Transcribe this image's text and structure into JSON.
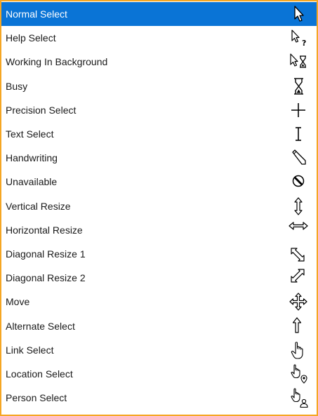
{
  "cursor_list": {
    "selected_index": 0,
    "items": [
      {
        "label": "Normal Select",
        "icon": "arrow-cursor-icon"
      },
      {
        "label": "Help Select",
        "icon": "arrow-question-cursor-icon"
      },
      {
        "label": "Working In Background",
        "icon": "arrow-hourglass-cursor-icon"
      },
      {
        "label": "Busy",
        "icon": "hourglass-cursor-icon"
      },
      {
        "label": "Precision Select",
        "icon": "crosshair-cursor-icon"
      },
      {
        "label": "Text Select",
        "icon": "ibeam-cursor-icon"
      },
      {
        "label": "Handwriting",
        "icon": "pen-cursor-icon"
      },
      {
        "label": "Unavailable",
        "icon": "no-symbol-cursor-icon"
      },
      {
        "label": "Vertical Resize",
        "icon": "vertical-resize-cursor-icon"
      },
      {
        "label": "Horizontal Resize",
        "icon": "horizontal-resize-cursor-icon"
      },
      {
        "label": "Diagonal Resize 1",
        "icon": "diagonal-resize-1-cursor-icon"
      },
      {
        "label": "Diagonal Resize 2",
        "icon": "diagonal-resize-2-cursor-icon"
      },
      {
        "label": "Move",
        "icon": "move-cursor-icon"
      },
      {
        "label": "Alternate Select",
        "icon": "up-arrow-cursor-icon"
      },
      {
        "label": "Link Select",
        "icon": "hand-cursor-icon"
      },
      {
        "label": "Location Select",
        "icon": "hand-pin-cursor-icon"
      },
      {
        "label": "Person Select",
        "icon": "hand-person-cursor-icon"
      }
    ]
  },
  "colors": {
    "selection_bg": "#0a74d6",
    "selection_text": "#ffffff",
    "frame_border": "#f5a623",
    "text": "#1a1a1a"
  }
}
